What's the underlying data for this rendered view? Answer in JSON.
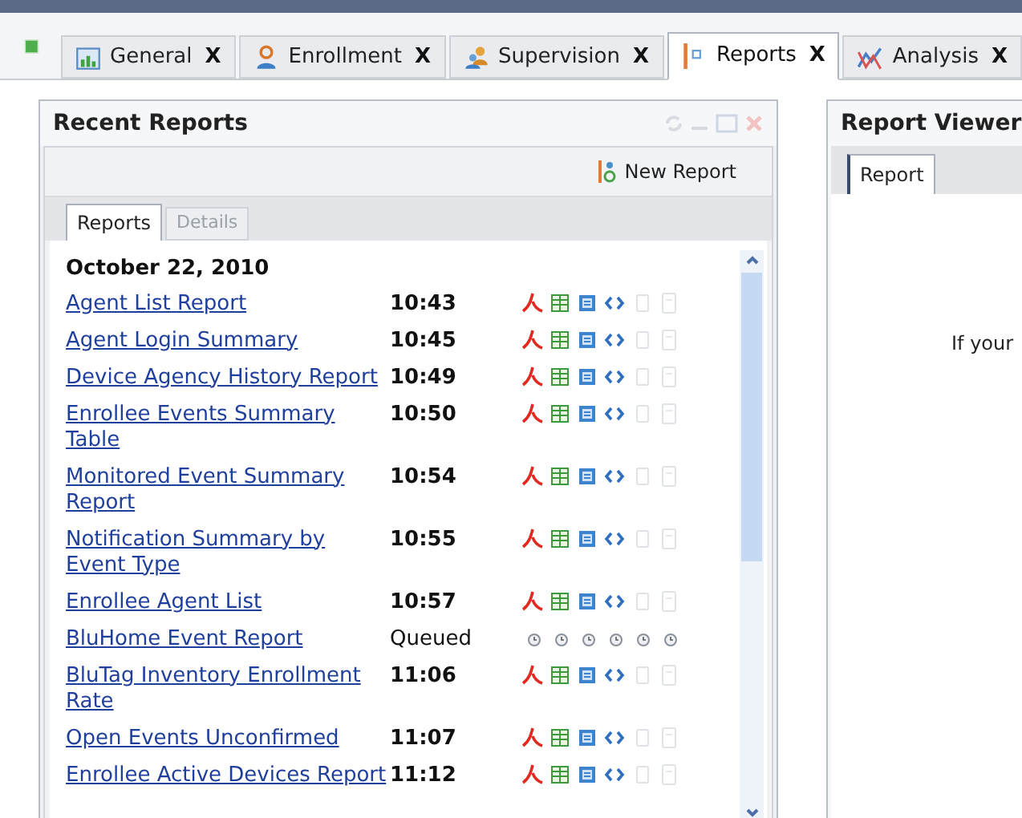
{
  "tabs": [
    {
      "label": "General",
      "selected": false,
      "close": "X"
    },
    {
      "label": "Enrollment",
      "selected": false,
      "close": "X"
    },
    {
      "label": "Supervision",
      "selected": false,
      "close": "X"
    },
    {
      "label": "Reports",
      "selected": true,
      "close": "X"
    },
    {
      "label": "Analysis",
      "selected": false,
      "close": "X"
    }
  ],
  "recent_reports": {
    "title": "Recent Reports",
    "new_report_button": "New Report",
    "tabs": [
      {
        "label": "Reports",
        "selected": true,
        "disabled": false
      },
      {
        "label": "Details",
        "selected": false,
        "disabled": true
      }
    ],
    "date": "October 22, 2010",
    "rows": [
      {
        "name": "Agent List Report",
        "time": "10:43",
        "kind": "done"
      },
      {
        "name": "Agent Login Summary",
        "time": "10:45",
        "kind": "done"
      },
      {
        "name": "Device Agency History Report",
        "time": "10:49",
        "kind": "done"
      },
      {
        "name": "Enrollee Events Summary Table",
        "time": "10:50",
        "kind": "done"
      },
      {
        "name": "Monitored Event Summary Report",
        "time": "10:54",
        "kind": "done"
      },
      {
        "name": "Notification Summary by Event Type",
        "time": "10:55",
        "kind": "done"
      },
      {
        "name": "Enrollee Agent List",
        "time": "10:57",
        "kind": "done"
      },
      {
        "name": "BluHome Event Report",
        "time": "Queued",
        "kind": "queued"
      },
      {
        "name": "BluTag Inventory Enrollment Rate",
        "time": "11:06",
        "kind": "done"
      },
      {
        "name": "Open Events Unconfirmed",
        "time": "11:07",
        "kind": "done"
      },
      {
        "name": "Enrollee Active Devices Report",
        "time": "11:12",
        "kind": "done"
      }
    ]
  },
  "report_viewer": {
    "title": "Report Viewer",
    "tabs": [
      {
        "label": "Report",
        "selected": true
      }
    ],
    "message": "If your"
  }
}
